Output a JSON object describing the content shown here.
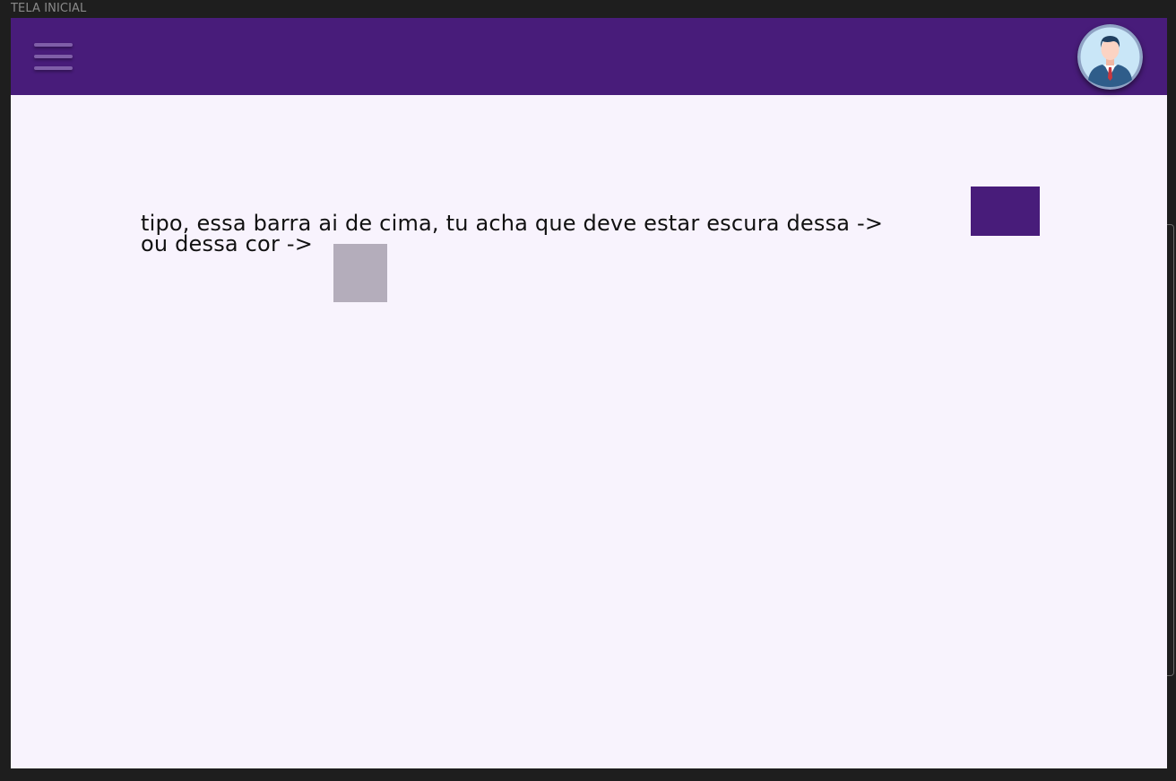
{
  "window": {
    "title": "TELA INICIAL"
  },
  "appbar": {
    "color": "#481c7a",
    "menu_icon": "hamburger-menu-icon",
    "avatar_icon": "businessman-avatar-icon"
  },
  "content": {
    "line1": "tipo, essa barra ai de cima, tu acha que deve estar escura dessa ->",
    "line2": "ou dessa cor ->",
    "background": "#f8f3fd"
  },
  "swatches": {
    "dark_color": "#481c7a",
    "light_color": "#b4adbb"
  }
}
